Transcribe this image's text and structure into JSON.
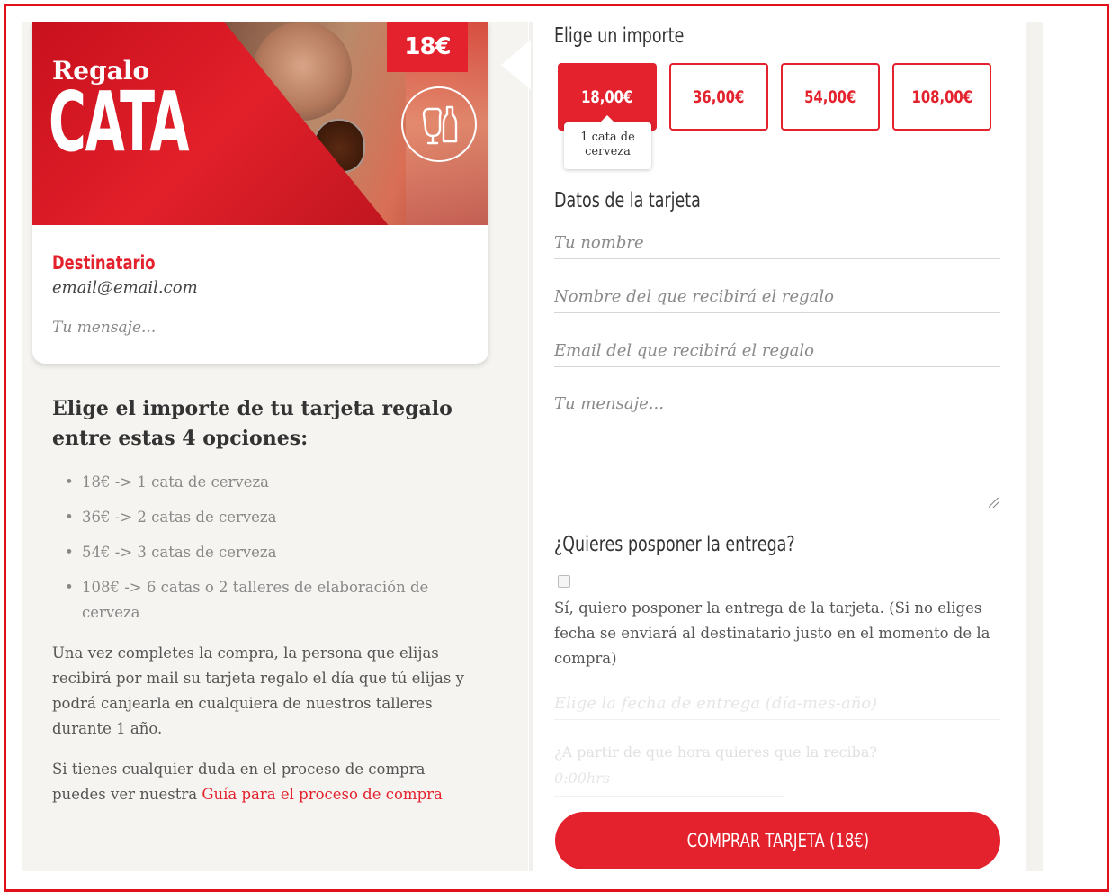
{
  "card": {
    "title_small": "Regalo",
    "title_big": "CATA",
    "price_badge": "18€",
    "recipient_label": "Destinatario",
    "recipient_email": "email@email.com",
    "message_placeholder": "Tu mensaje..."
  },
  "info": {
    "heading": "Elige el importe de tu tarjeta regalo entre estas 4 opciones:",
    "options": [
      "18€ -> 1 cata de cerveza",
      "36€ -> 2 catas de cerveza",
      "54€ -> 3 catas de cerveza",
      "108€ -> 6 catas o 2 talleres de elaboración de cerveza"
    ],
    "paragraph1": "Una vez completes la compra, la persona que elijas recibirá por mail su tarjeta regalo el día que tú elijas y podrá canjearla en cualquiera de nuestros talleres durante 1 año.",
    "paragraph2_prefix": "Si tienes cualquier duda en el proceso de compra puedes ver nuestra",
    "guide_link": "Guía para el proceso de compra"
  },
  "form": {
    "amount_title": "Elige un importe",
    "amounts": [
      "18,00€",
      "36,00€",
      "54,00€",
      "108,00€"
    ],
    "selected_amount_tooltip": "1 cata de cerveza",
    "card_data_title": "Datos de la tarjeta",
    "name_placeholder": "Tu nombre",
    "recipient_name_placeholder": "Nombre del que recibirá el regalo",
    "recipient_email_placeholder": "Email del que recibirá el regalo",
    "message_placeholder": "Tu mensaje...",
    "postpone_title": "¿Quieres posponer la entrega?",
    "postpone_checkbox_text": "Sí, quiero posponer la entrega de la tarjeta. (Si no eliges fecha se enviará al destinatario justo en el momento de la compra)",
    "date_placeholder": "Elige la fecha de entrega (día-mes-año)",
    "hour_label": "¿A partir de que hora quieres que la reciba?",
    "hour_value": "0:00hrs",
    "buy_button": "COMPRAR TARJETA (18€)"
  },
  "colors": {
    "accent": "#e3222d",
    "panel_bg": "#f5f4f0"
  }
}
